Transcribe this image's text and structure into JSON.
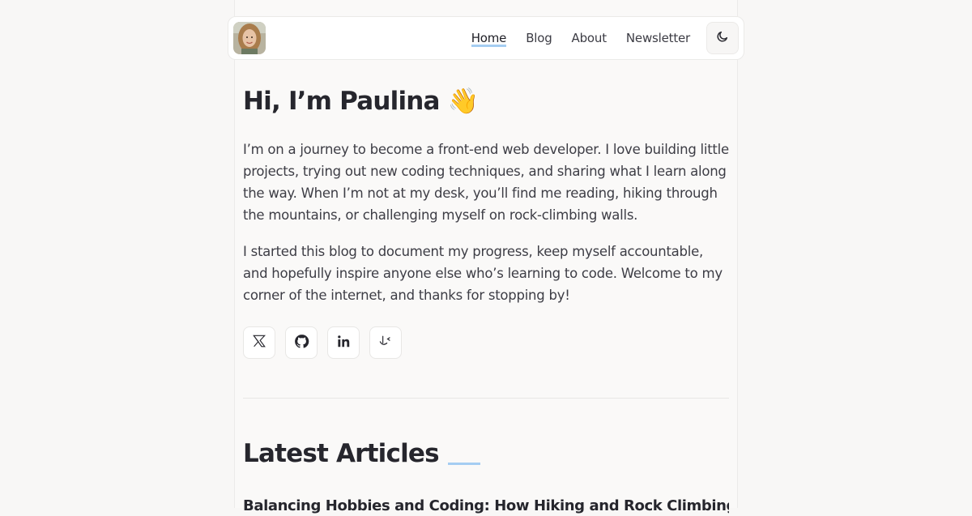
{
  "nav": {
    "links": [
      {
        "label": "Home",
        "active": true
      },
      {
        "label": "Blog",
        "active": false
      },
      {
        "label": "About",
        "active": false
      },
      {
        "label": "Newsletter",
        "active": false
      }
    ],
    "theme_toggle_icon": "moon-icon"
  },
  "hero": {
    "title": "Hi, I’m Paulina 👋",
    "paragraphs": [
      "I’m on a journey to become a front-end web developer. I love building little projects, trying out new coding techniques, and sharing what I learn along the way. When I’m not at my desk, you’ll find me reading, hiking through the mountains, or challenging myself on rock-climbing walls.",
      "I started this blog to document my progress, keep myself accountable, and hopefully inspire anyone else who’s learning to code. Welcome to my corner of the internet, and thanks for stopping by!"
    ]
  },
  "socials": [
    {
      "icon": "x-twitter-icon"
    },
    {
      "icon": "github-icon"
    },
    {
      "icon": "linkedin-icon"
    },
    {
      "icon": "frontend-mentor-icon"
    }
  ],
  "articles": {
    "section_title": "Latest Articles",
    "items": [
      {
        "title": "Balancing Hobbies and Coding: How Hiking and Rock Climbing"
      }
    ]
  },
  "colors": {
    "accent": "#a5cdf2",
    "background": "#f8f7f6",
    "text": "#26262d"
  }
}
